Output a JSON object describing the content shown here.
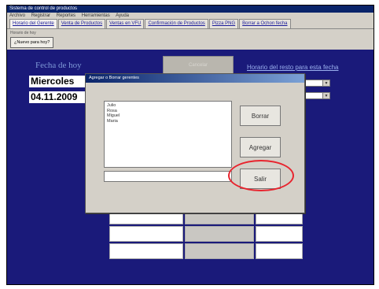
{
  "window": {
    "title": "Sistema de control de productos"
  },
  "menu": {
    "items": [
      "Archivo",
      "Registrar",
      "Reportes",
      "Herramientas",
      "Ayuda"
    ]
  },
  "tabs": [
    {
      "label": "Horario del Gerente"
    },
    {
      "label": "Venta de Productos"
    },
    {
      "label": "Ventas en VFU"
    },
    {
      "label": "Confirmación de Productos"
    },
    {
      "label": "Pizza PNG"
    },
    {
      "label": "Borrar a Ochon fecha"
    }
  ],
  "subtab": {
    "label": "Horario de hoy",
    "button": "¿Nuevo para hoy?"
  },
  "main": {
    "date_label": "Fecha de hoy",
    "day": "Miercoles",
    "date": "04.11.2009",
    "cancel_button": "Cancelar",
    "schedule_link": "Horario del resto para esta fecha"
  },
  "dialog": {
    "title": "Agregar o Borrar gerentes",
    "list_items": [
      "Julio",
      "Rosa",
      "Miguel",
      "Maria"
    ],
    "input_value": "",
    "buttons": {
      "delete": "Borrar",
      "add": "Agregar",
      "exit": "Salir"
    }
  },
  "colors": {
    "background": "#1a1a7a",
    "highlight": "#e8242e"
  }
}
